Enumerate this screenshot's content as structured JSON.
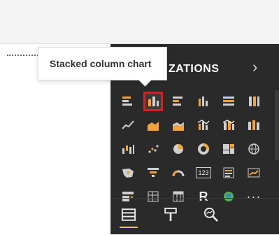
{
  "tooltip": {
    "text": "Stacked column chart"
  },
  "pane": {
    "title_visible": "ZATIONS",
    "collapse_icon": "chevron-right-icon"
  },
  "visuals": [
    {
      "name": "stacked-bar-icon"
    },
    {
      "name": "stacked-column-icon",
      "selected": true
    },
    {
      "name": "clustered-bar-icon"
    },
    {
      "name": "clustered-column-icon"
    },
    {
      "name": "100-stacked-bar-icon"
    },
    {
      "name": "100-stacked-column-icon"
    },
    {
      "name": "line-chart-icon"
    },
    {
      "name": "area-chart-icon"
    },
    {
      "name": "stacked-area-icon"
    },
    {
      "name": "line-clustered-column-icon"
    },
    {
      "name": "line-stacked-column-icon"
    },
    {
      "name": "ribbon-chart-icon"
    },
    {
      "name": "waterfall-icon"
    },
    {
      "name": "scatter-icon"
    },
    {
      "name": "pie-icon"
    },
    {
      "name": "donut-icon"
    },
    {
      "name": "treemap-icon"
    },
    {
      "name": "map-icon"
    },
    {
      "name": "filled-map-icon"
    },
    {
      "name": "funnel-icon"
    },
    {
      "name": "gauge-icon"
    },
    {
      "name": "card-icon",
      "text": "123"
    },
    {
      "name": "multi-row-card-icon"
    },
    {
      "name": "kpi-icon"
    },
    {
      "name": "slicer-icon"
    },
    {
      "name": "table-icon"
    },
    {
      "name": "matrix-icon"
    },
    {
      "name": "r-visual-icon",
      "text": "R"
    },
    {
      "name": "globe-icon"
    },
    {
      "name": "more-visuals-icon",
      "text": "···"
    }
  ],
  "bottom_tabs": [
    {
      "name": "fields-icon",
      "active": true
    },
    {
      "name": "format-paint-icon"
    },
    {
      "name": "analytics-icon"
    }
  ],
  "colors": {
    "pane_bg": "#2a2a2a",
    "accent_yellow": "#ffd400",
    "selection_red": "#d62020"
  }
}
